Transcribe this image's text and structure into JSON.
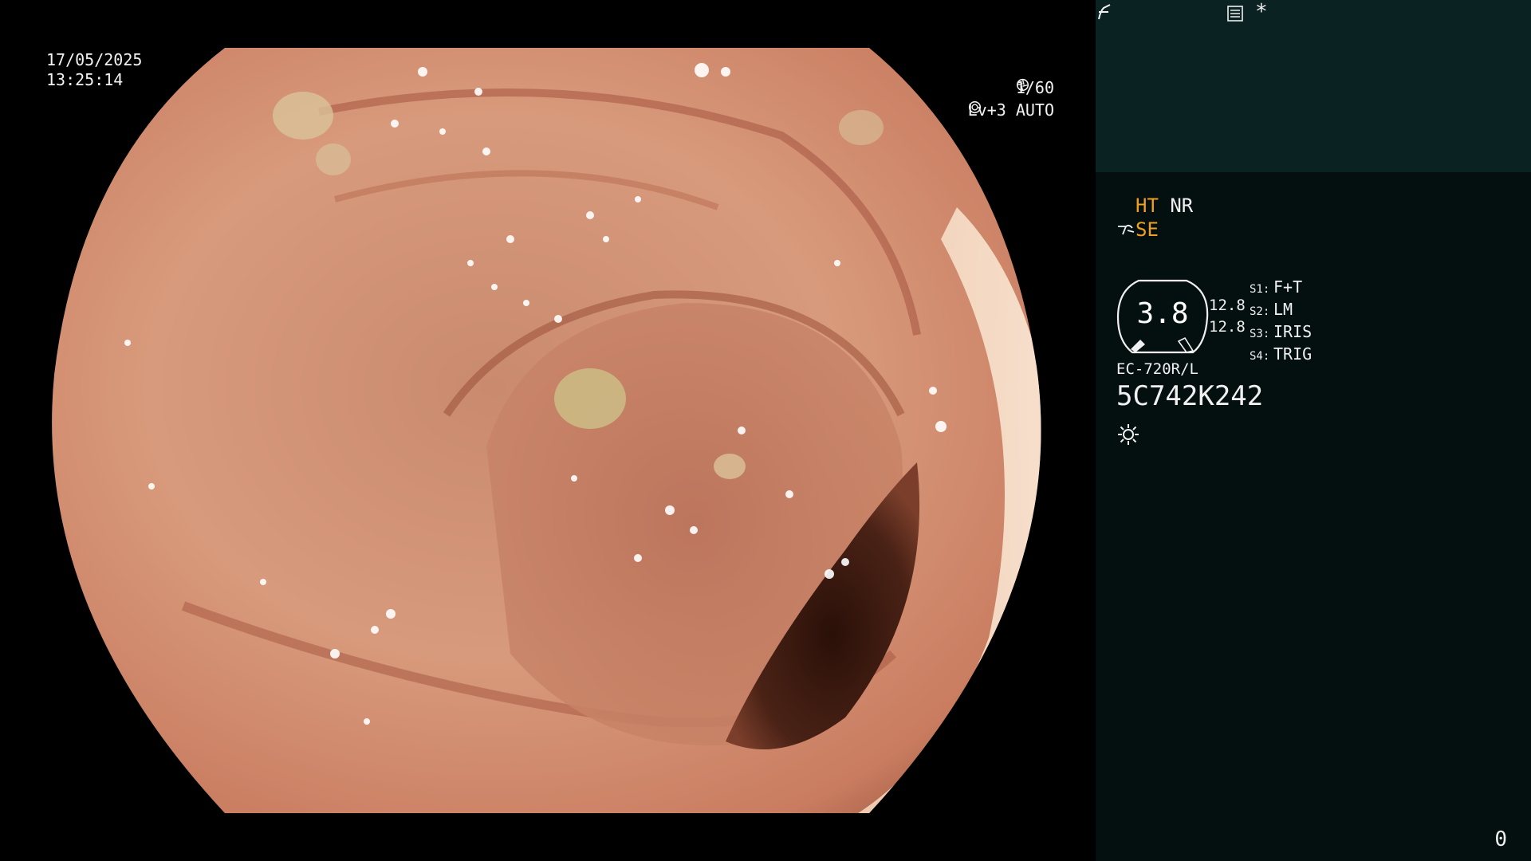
{
  "overlay": {
    "date": "17/05/2025",
    "time": "13:25:14",
    "shutter": "1/60",
    "shutter_icon": "shutter-icon",
    "exposure": "Lv+3 AUTO",
    "exposure_icon": "iris-icon"
  },
  "panel": {
    "ht": "HT",
    "nr": "NR",
    "se": "SE",
    "structure_icon": "structure-enhance-icon",
    "freeze_icon": "freeze-icon",
    "menu_icon": "list-icon",
    "asterisk": "*",
    "gauge_value": "3.8",
    "level_1": "12.8",
    "level_2": "12.8",
    "slots": [
      {
        "key": "S1:",
        "value": "F+T"
      },
      {
        "key": "S2:",
        "value": "LM"
      },
      {
        "key": "S3:",
        "value": "IRIS"
      },
      {
        "key": "S4:",
        "value": "TRIG"
      }
    ],
    "model": "EC-720R/L",
    "serial": "5C742K242",
    "light_icon": "sun-icon",
    "counter": "0"
  },
  "colors": {
    "highlight": "#f0a020",
    "panel_top": "#0b2222",
    "panel_bottom": "#041010",
    "text": "#f0f0f0"
  }
}
